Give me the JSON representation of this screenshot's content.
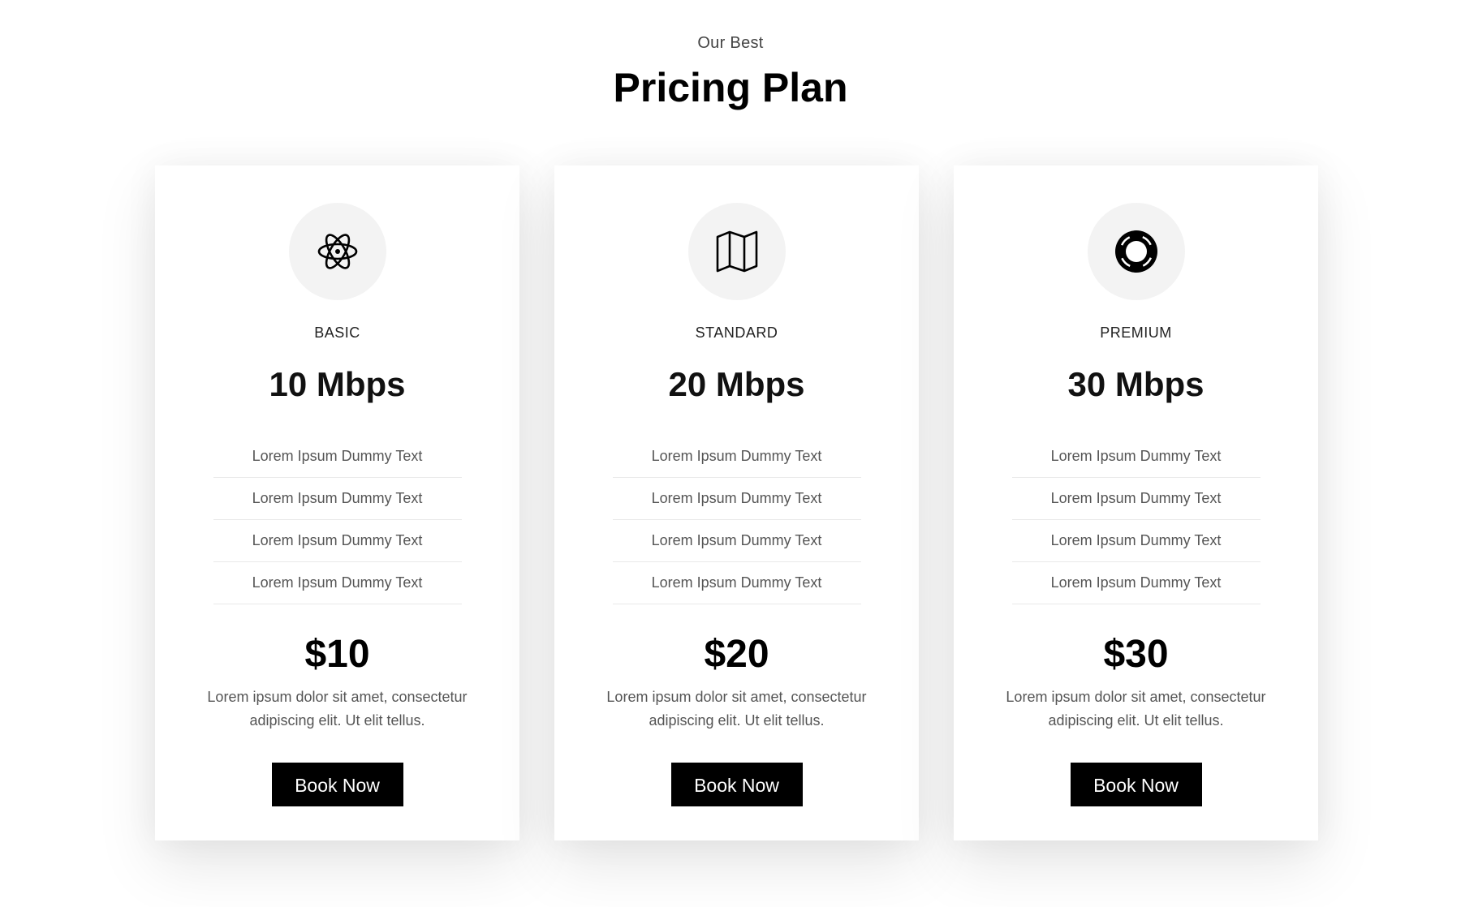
{
  "header": {
    "subtitle": "Our Best",
    "title": "Pricing Plan"
  },
  "plans": [
    {
      "icon": "atom-icon",
      "name": "BASIC",
      "speed": "10 Mbps",
      "features": [
        "Lorem Ipsum Dummy Text",
        "Lorem Ipsum Dummy Text",
        "Lorem Ipsum Dummy Text",
        "Lorem Ipsum Dummy Text"
      ],
      "price": "$10",
      "description": "Lorem ipsum dolor sit amet, consectetur adipiscing elit. Ut elit tellus.",
      "button_label": "Book Now"
    },
    {
      "icon": "map-icon",
      "name": "STANDARD",
      "speed": "20 Mbps",
      "features": [
        "Lorem Ipsum Dummy Text",
        "Lorem Ipsum Dummy Text",
        "Lorem Ipsum Dummy Text",
        "Lorem Ipsum Dummy Text"
      ],
      "price": "$20",
      "description": "Lorem ipsum dolor sit amet, consectetur adipiscing elit. Ut elit tellus.",
      "button_label": "Book Now"
    },
    {
      "icon": "lifebuoy-icon",
      "name": "PREMIUM",
      "speed": "30 Mbps",
      "features": [
        "Lorem Ipsum Dummy Text",
        "Lorem Ipsum Dummy Text",
        "Lorem Ipsum Dummy Text",
        "Lorem Ipsum Dummy Text"
      ],
      "price": "$30",
      "description": "Lorem ipsum dolor sit amet, consectetur adipiscing elit. Ut elit tellus.",
      "button_label": "Book Now"
    }
  ],
  "colors": {
    "button_bg": "#000000",
    "button_text": "#ffffff",
    "icon_circle_bg": "#f3f3f3"
  }
}
